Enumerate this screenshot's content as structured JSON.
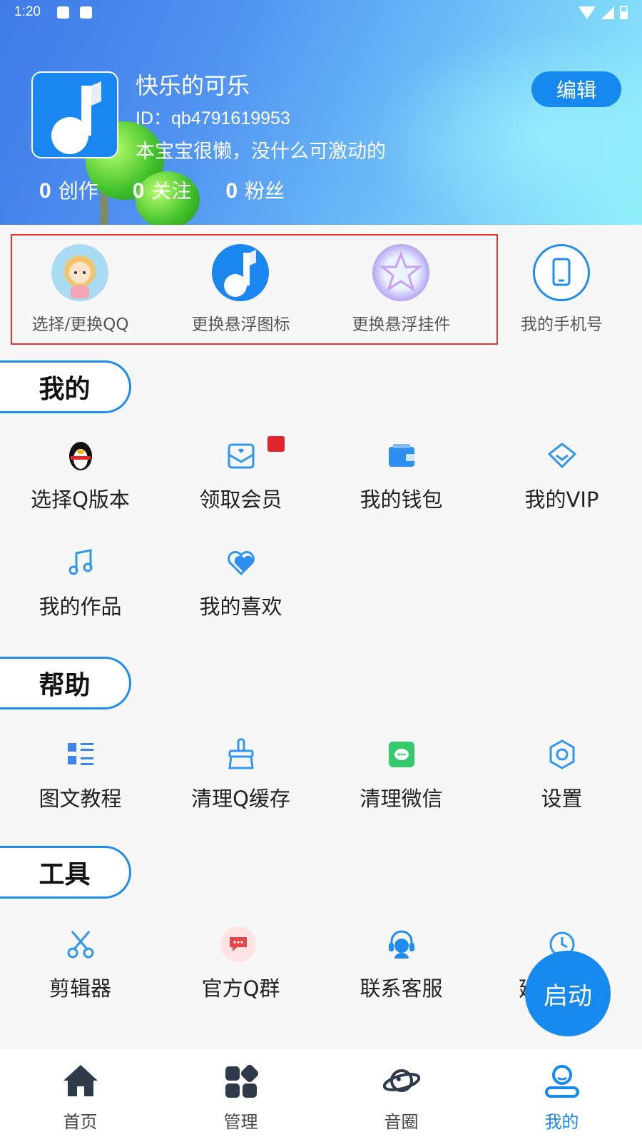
{
  "status_bar": {
    "time": "1:20"
  },
  "profile": {
    "name": "快乐的可乐",
    "id_text": "ID：qb4791619953",
    "bio": "本宝宝很懒，没什么可激动的",
    "stats": [
      {
        "num": "0",
        "label": "创作"
      },
      {
        "num": "0",
        "label": "关注"
      },
      {
        "num": "0",
        "label": "粉丝"
      }
    ],
    "edit_label": "编辑"
  },
  "quick_actions": [
    {
      "label": "选择/更换QQ",
      "icon": "cartoon-girl-avatar-icon"
    },
    {
      "label": "更换悬浮图标",
      "icon": "music-note-icon"
    },
    {
      "label": "更换悬浮挂件",
      "icon": "star-pendant-icon"
    },
    {
      "label": "我的手机号",
      "icon": "phone-icon"
    }
  ],
  "sections": {
    "mine": {
      "title": "我的",
      "items": [
        {
          "label": "选择Q版本",
          "icon": "penguin-icon"
        },
        {
          "label": "领取会员",
          "icon": "gift-envelope-icon"
        },
        {
          "label": "我的钱包",
          "icon": "wallet-icon"
        },
        {
          "label": "我的VIP",
          "icon": "diamond-icon"
        },
        {
          "label": "我的作品",
          "icon": "music-icon"
        },
        {
          "label": "我的喜欢",
          "icon": "heart-icon"
        }
      ]
    },
    "help": {
      "title": "帮助",
      "items": [
        {
          "label": "图文教程",
          "icon": "list-icon"
        },
        {
          "label": "清理Q缓存",
          "icon": "broom-icon"
        },
        {
          "label": "清理微信",
          "icon": "chat-icon"
        },
        {
          "label": "设置",
          "icon": "gear-icon"
        }
      ]
    },
    "tools": {
      "title": "工具",
      "items": [
        {
          "label": "剪辑器",
          "icon": "scissors-icon"
        },
        {
          "label": "官方Q群",
          "icon": "group-chat-icon"
        },
        {
          "label": "联系客服",
          "icon": "headset-icon"
        },
        {
          "label": "延",
          "icon": "clock-icon"
        }
      ]
    }
  },
  "fab_label": "启动",
  "bottom_nav": [
    {
      "label": "首页",
      "icon": "home-icon"
    },
    {
      "label": "管理",
      "icon": "apps-icon"
    },
    {
      "label": "音圈",
      "icon": "planet-icon"
    },
    {
      "label": "我的",
      "icon": "profile-icon",
      "active": true
    }
  ],
  "colors": {
    "accent": "#1689ee",
    "highlight_box": "#ee3333"
  }
}
